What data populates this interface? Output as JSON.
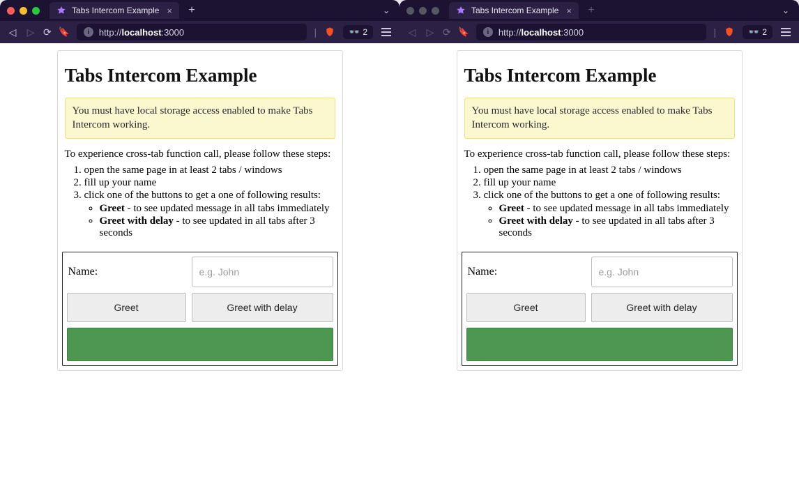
{
  "windows": [
    {
      "focused": true,
      "traffic": "color",
      "tab_title": "Tabs Intercom Example",
      "url_scheme": "http://",
      "url_host": "localhost",
      "url_port": ":3000",
      "badge_count": "2"
    },
    {
      "focused": false,
      "traffic": "dim",
      "tab_title": "Tabs Intercom Example",
      "url_scheme": "http://",
      "url_host": "localhost",
      "url_port": ":3000",
      "badge_count": "2"
    }
  ],
  "page": {
    "title": "Tabs Intercom Example",
    "warning": "You must have local storage access enabled to make Tabs Intercom working.",
    "intro": "To experience cross-tab function call, please follow these steps:",
    "steps": [
      "open the same page in at least 2 tabs / windows",
      "fill up your name",
      "click one of the buttons to get a one of following results:"
    ],
    "substeps": [
      {
        "strong": "Greet",
        "rest": " - to see updated message in all tabs immediately"
      },
      {
        "strong": "Greet with delay",
        "rest": " - to see updated in all tabs after 3 seconds"
      }
    ],
    "name_label": "Name:",
    "name_placeholder": "e.g. John",
    "greet_label": "Greet",
    "greet_delay_label": "Greet with delay"
  }
}
